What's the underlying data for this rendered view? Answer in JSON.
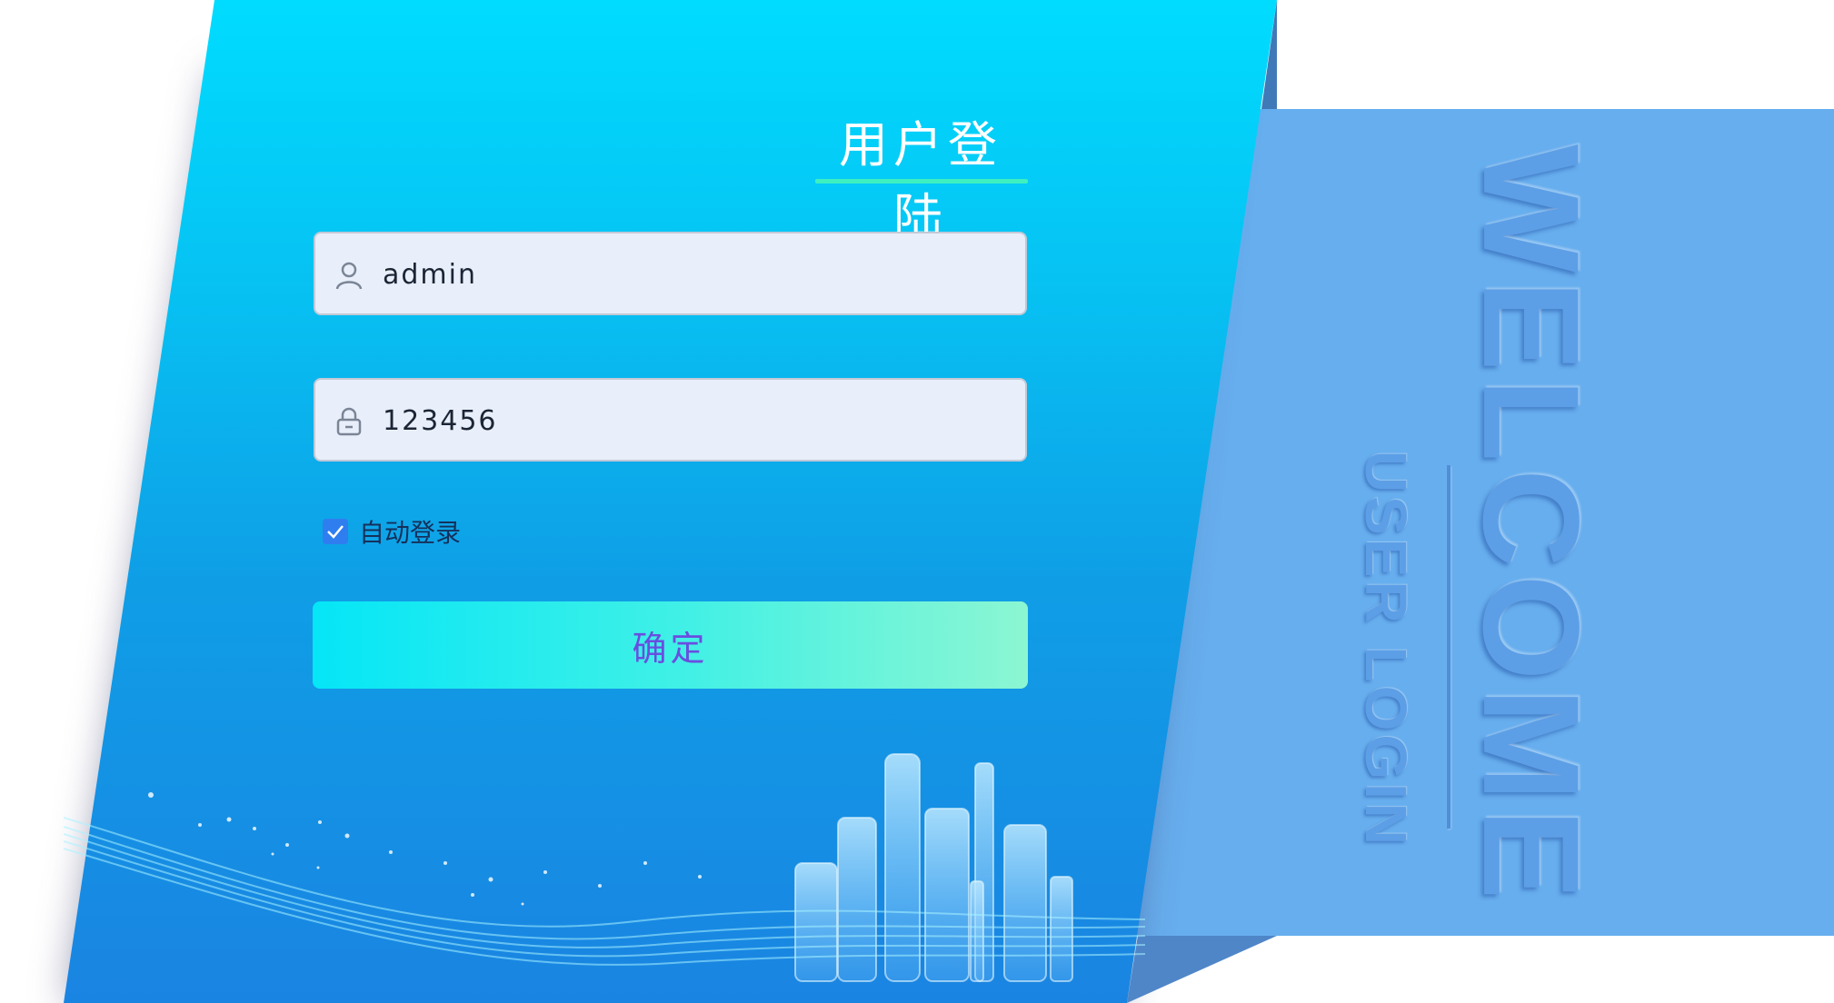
{
  "login": {
    "title": "用户登陆",
    "username": {
      "value": "admin",
      "icon": "user-icon"
    },
    "password": {
      "value": "123456",
      "icon": "lock-icon"
    },
    "remember": {
      "label": "自动登录",
      "checked": true
    },
    "submit_label": "确定"
  },
  "welcome": {
    "headline": "WELCOME",
    "subtitle": "USER LOGIN"
  },
  "colors": {
    "card_top": "#00dcff",
    "card_bottom": "#1a84e2",
    "panel": "#67aeee",
    "accent_underline": "#3ef0c0",
    "checkbox": "#2e7ef0",
    "button_text": "#6a4de0"
  }
}
